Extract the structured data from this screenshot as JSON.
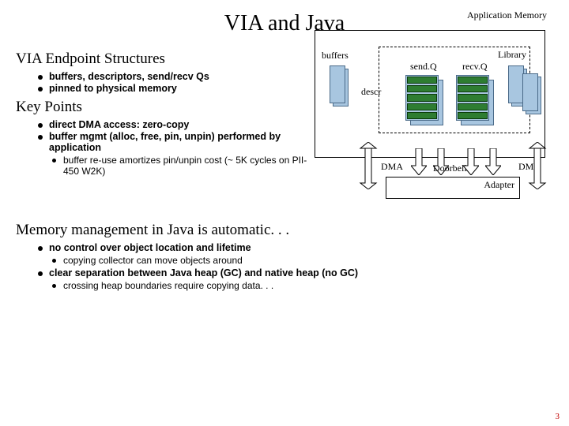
{
  "title": "VIA and Java",
  "sections": {
    "endpoint": {
      "heading": "VIA Endpoint Structures",
      "items": [
        "buffers, descriptors, send/recv Qs",
        "pinned to physical memory"
      ]
    },
    "keypoints": {
      "heading": "Key Points",
      "items": [
        "direct DMA access: zero-copy",
        "buffer mgmt (alloc, free, pin, unpin) performed by application"
      ],
      "sub": [
        "buffer re-use amortizes pin/unpin cost (~ 5K cycles on PII-450 W2K)"
      ]
    },
    "mem": {
      "heading": "Memory management in Java is automatic. . .",
      "items": [
        "no control over object location and lifetime",
        "clear separation between Java heap (GC) and native heap (no GC)"
      ],
      "sub1": [
        "copying collector can move objects around"
      ],
      "sub2": [
        "crossing heap boundaries require copying data. . ."
      ]
    }
  },
  "diagram": {
    "appMemory": "Application Memory",
    "library": "Library",
    "buffers": "buffers",
    "sendQ": "send.Q",
    "recvQ": "recv.Q",
    "descr": "descr",
    "dma": "DMA",
    "doorbells": "Doorbells",
    "adapter": "Adapter"
  },
  "pagenum": "3"
}
